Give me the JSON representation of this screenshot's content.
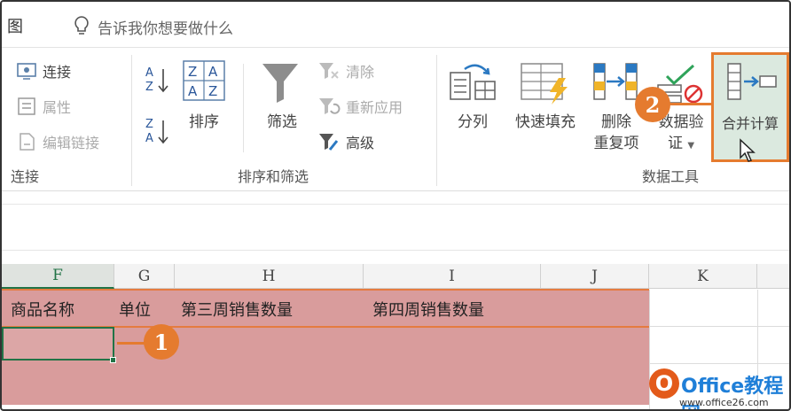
{
  "tellbar": {
    "tab_partial": "图",
    "tell_me": "告诉我你想要做什么"
  },
  "ribbon": {
    "connections": {
      "connect": "连接",
      "properties": "属性",
      "edit_links": "编辑链接",
      "group": "连接"
    },
    "sort_filter": {
      "sort": "排序",
      "filter": "筛选",
      "clear": "清除",
      "reapply": "重新应用",
      "advanced": "高级",
      "group": "排序和筛选"
    },
    "data_tools": {
      "text_to_columns": "分列",
      "flash_fill": "快速填充",
      "remove_dup_1": "删除",
      "remove_dup_2": "重复项",
      "validation_1": "数据验",
      "validation_2": "证",
      "consolidate": "合并计算",
      "group": "数据工具"
    }
  },
  "columns": [
    "F",
    "G",
    "H",
    "I",
    "J",
    "K"
  ],
  "sheet": {
    "headers": [
      "商品名称",
      "单位",
      "第三周销售数量",
      "第四周销售数量"
    ]
  },
  "callouts": {
    "one": "1",
    "two": "2"
  },
  "watermark": {
    "logo": "O",
    "title": "Office教程网",
    "url": "www.office26.com"
  },
  "colors": {
    "accent_orange": "#e57b2f",
    "highlight_fill": "#d99c9c",
    "excel_green": "#217346"
  }
}
